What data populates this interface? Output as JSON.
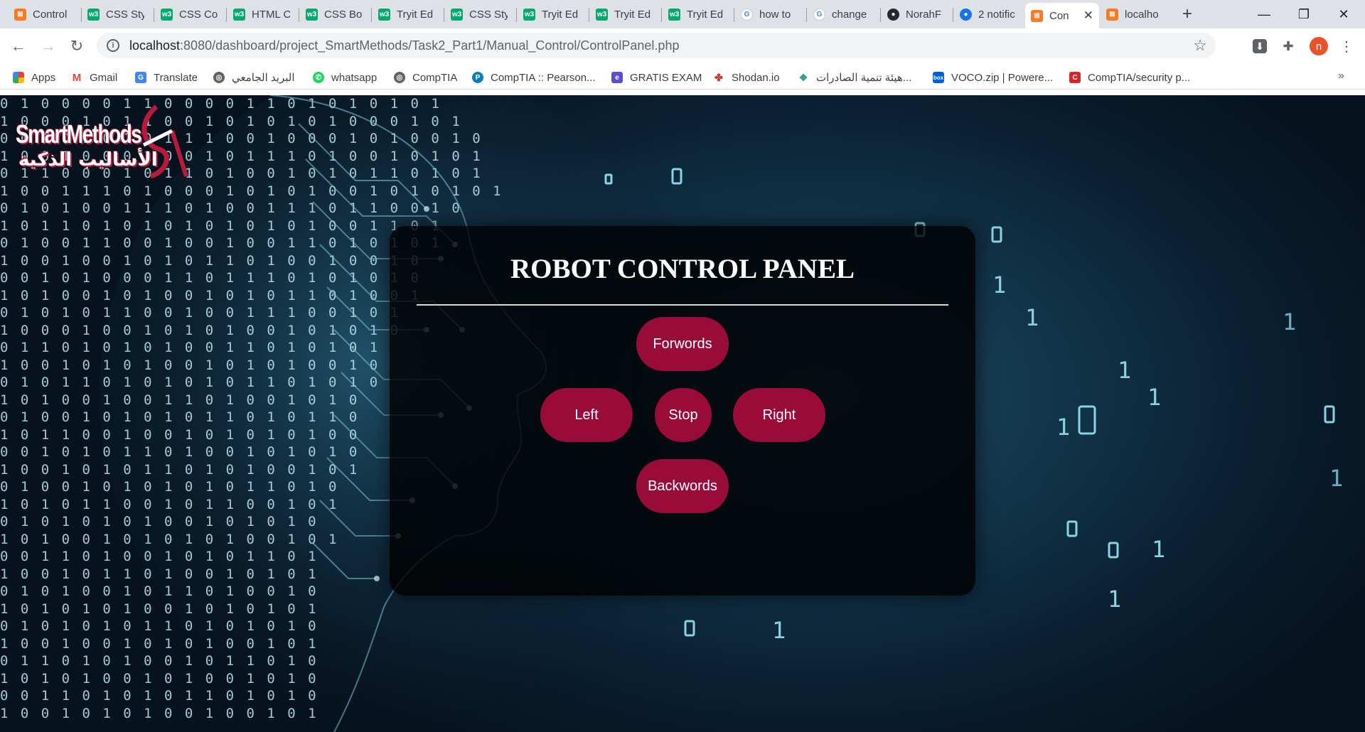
{
  "browser": {
    "tabs": [
      {
        "label": "Control",
        "icon": "xampp-icon"
      },
      {
        "label": "CSS Sty",
        "icon": "w3schools-icon"
      },
      {
        "label": "CSS Col",
        "icon": "w3schools-icon"
      },
      {
        "label": "HTML C",
        "icon": "w3schools-icon"
      },
      {
        "label": "CSS Bor",
        "icon": "w3schools-icon"
      },
      {
        "label": "Tryit Ed",
        "icon": "w3schools-icon"
      },
      {
        "label": "CSS Sty",
        "icon": "w3schools-icon"
      },
      {
        "label": "Tryit Ed",
        "icon": "w3schools-icon"
      },
      {
        "label": "Tryit Ed",
        "icon": "w3schools-icon"
      },
      {
        "label": "Tryit Ed",
        "icon": "w3schools-icon"
      },
      {
        "label": "how to",
        "icon": "google-icon"
      },
      {
        "label": "change",
        "icon": "google-icon"
      },
      {
        "label": "NorahF",
        "icon": "github-icon"
      },
      {
        "label": "2 notific",
        "icon": "notification-icon"
      },
      {
        "label": "Con",
        "icon": "xampp-icon",
        "active": true
      },
      {
        "label": "localho",
        "icon": "xampp-icon"
      }
    ],
    "url_host": "localhost",
    "url_path": ":8080/dashboard/project_SmartMethods/Task2_Part1/Manual_Control/ControlPanel.php",
    "profile_initial": "n",
    "bookmarks": [
      {
        "label": "Apps",
        "icon": "apps-grid-icon"
      },
      {
        "label": "Gmail",
        "icon": "gmail-icon"
      },
      {
        "label": "Translate",
        "icon": "translate-icon"
      },
      {
        "label": "البريد الجامعي",
        "icon": "globe-icon"
      },
      {
        "label": "whatsapp",
        "icon": "whatsapp-icon"
      },
      {
        "label": "CompTIA",
        "icon": "globe-icon"
      },
      {
        "label": "CompTIA :: Pearson...",
        "icon": "pearson-icon"
      },
      {
        "label": "GRATIS EXAM",
        "icon": "gratis-icon"
      },
      {
        "label": "Shodan.io",
        "icon": "shodan-icon"
      },
      {
        "label": "هيئة تنمية الصادرات...",
        "icon": "leaf-icon"
      },
      {
        "label": "VOCO.zip | Powere...",
        "icon": "box-icon"
      },
      {
        "label": "CompTIA/security p...",
        "icon": "comptia-icon"
      }
    ]
  },
  "page": {
    "logo_en": "SmartMethods",
    "logo_ar": "الأساليب الذكية",
    "panel_title": "ROBOT CONTROL PANEL",
    "buttons": {
      "forward": "Forwords",
      "left": "Left",
      "stop": "Stop",
      "right": "Right",
      "backward": "Backwords"
    }
  },
  "colors": {
    "button_bg": "#990c39",
    "panel_bg": "rgba(0,0,0,0.82)",
    "logo_accent": "#b81b3a"
  }
}
